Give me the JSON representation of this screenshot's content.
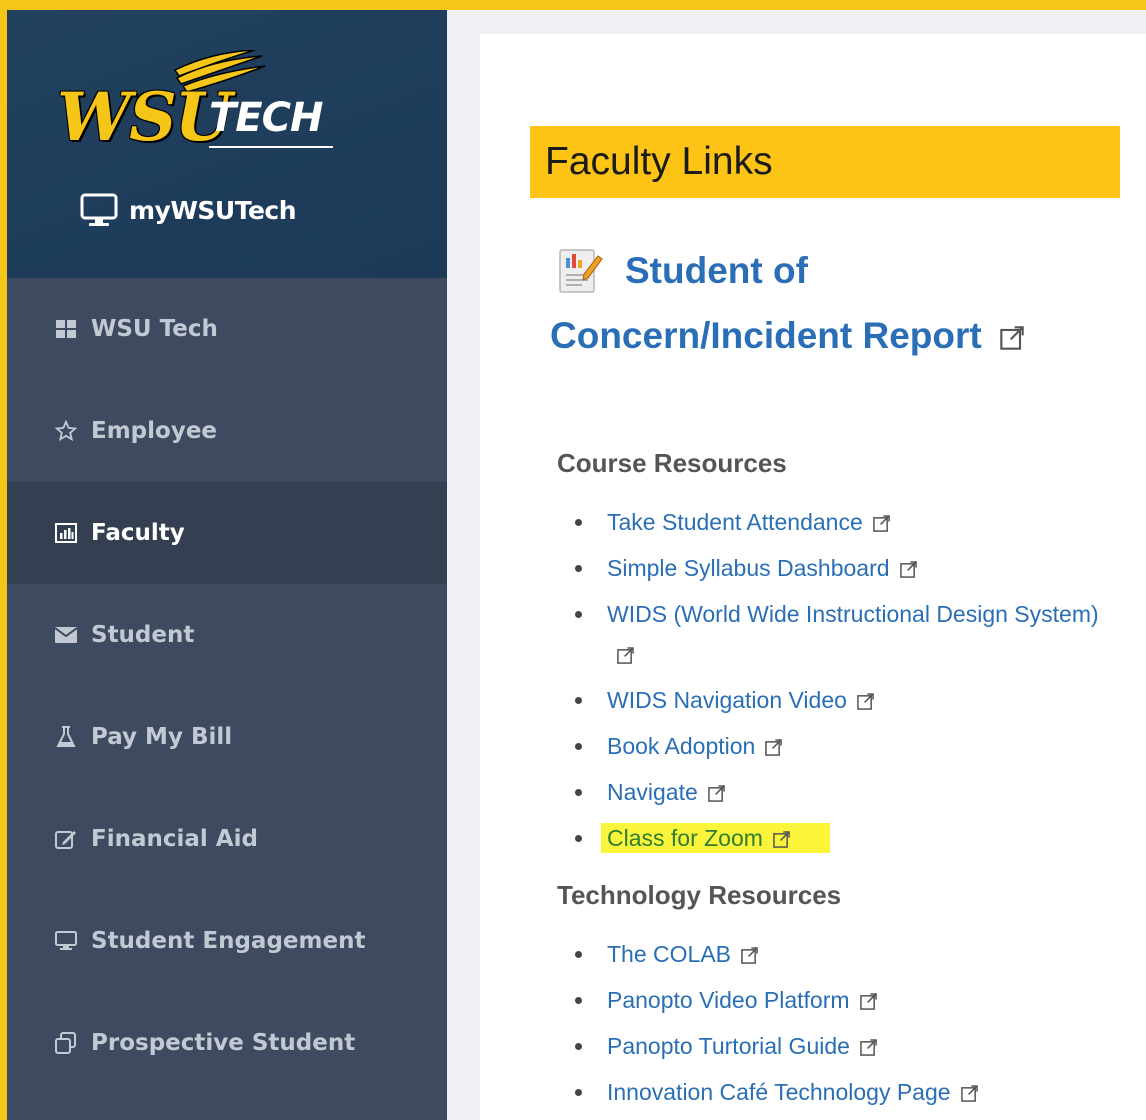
{
  "brand": {
    "logo_text": "WSU",
    "logo_tech": "TECH",
    "portal_label": "myWSUTech"
  },
  "nav": {
    "items": [
      {
        "label": "WSU Tech",
        "icon": "grid-icon"
      },
      {
        "label": "Employee",
        "icon": "star-icon"
      },
      {
        "label": "Faculty",
        "icon": "chart-icon",
        "active": true
      },
      {
        "label": "Student",
        "icon": "envelope-icon"
      },
      {
        "label": "Pay My Bill",
        "icon": "flask-icon"
      },
      {
        "label": "Financial Aid",
        "icon": "edit-icon"
      },
      {
        "label": "Student Engagement",
        "icon": "monitor-icon"
      },
      {
        "label": "Prospective Student",
        "icon": "copy-icon"
      }
    ]
  },
  "main": {
    "title": "Faculty Links",
    "report_line1": "Student of",
    "report_line2": "Concern/Incident Report",
    "course_heading": "Course Resources",
    "course_links": [
      {
        "label": "Take Student Attendance"
      },
      {
        "label": "Simple Syllabus Dashboard"
      },
      {
        "label": "WIDS (World Wide Instructional Design System)"
      },
      {
        "label": "WIDS Navigation Video"
      },
      {
        "label": "Book Adoption"
      },
      {
        "label": "Navigate"
      },
      {
        "label": "Class for Zoom",
        "highlighted": true
      }
    ],
    "tech_heading": "Technology Resources",
    "tech_links": [
      {
        "label": "The COLAB"
      },
      {
        "label": "Panopto Video Platform"
      },
      {
        "label": "Panopto Turtorial Guide"
      },
      {
        "label": "Innovation Café Technology Page"
      }
    ]
  },
  "colors": {
    "accent_gold": "#fdc315",
    "link_blue": "#2a6fb5",
    "sidebar": "#3d4a5f",
    "highlight": "#faf43a"
  }
}
